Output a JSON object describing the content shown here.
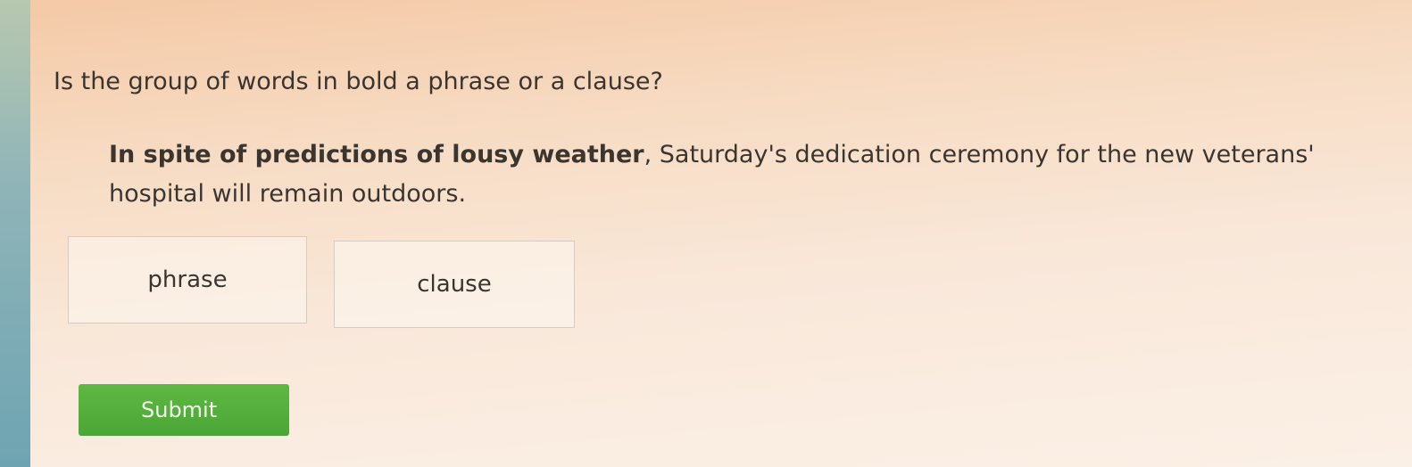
{
  "question": {
    "text": "Is the group of words in bold a phrase or a clause?"
  },
  "passage": {
    "bold_text": "In spite of predictions of lousy weather",
    "rest_text": ", Saturday's dedication ceremony for the new veterans' hospital will remain outdoors."
  },
  "choices": [
    {
      "label": "phrase"
    },
    {
      "label": "clause"
    }
  ],
  "submit": {
    "label": "Submit",
    "color": "#52ad3c"
  },
  "colors": {
    "background_warm": "#f7dcc4",
    "left_strip": "#7fabb5",
    "text": "#3b3530"
  }
}
